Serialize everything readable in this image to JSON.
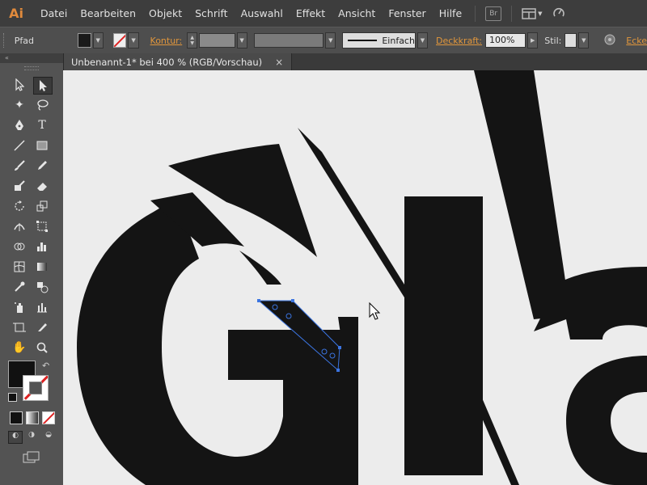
{
  "app": {
    "logo": "Ai",
    "accent": "#e08a3c"
  },
  "menu": [
    "Datei",
    "Bearbeiten",
    "Objekt",
    "Schrift",
    "Auswahl",
    "Effekt",
    "Ansicht",
    "Fenster",
    "Hilfe"
  ],
  "menu_icons": {
    "bridge": "Br",
    "arrange": "arrange-documents-icon",
    "gpu": "gpu-performance-icon"
  },
  "control": {
    "object_type": "Pfad",
    "contour_label": "Kontur:",
    "stroke_style": "Einfach",
    "opacity_label": "Deckkraft:",
    "opacity_value": "100%",
    "style_label": "Stil:",
    "overflow_label": "Ecke"
  },
  "document": {
    "tab_title": "Unbenannt-1* bei 400 % (RGB/Vorschau)",
    "close": "×"
  },
  "toolpanel": {
    "collapse": "«"
  },
  "colors": {
    "artwork": "#141414",
    "selection": "#3b74e0",
    "canvas": "#ececec"
  }
}
